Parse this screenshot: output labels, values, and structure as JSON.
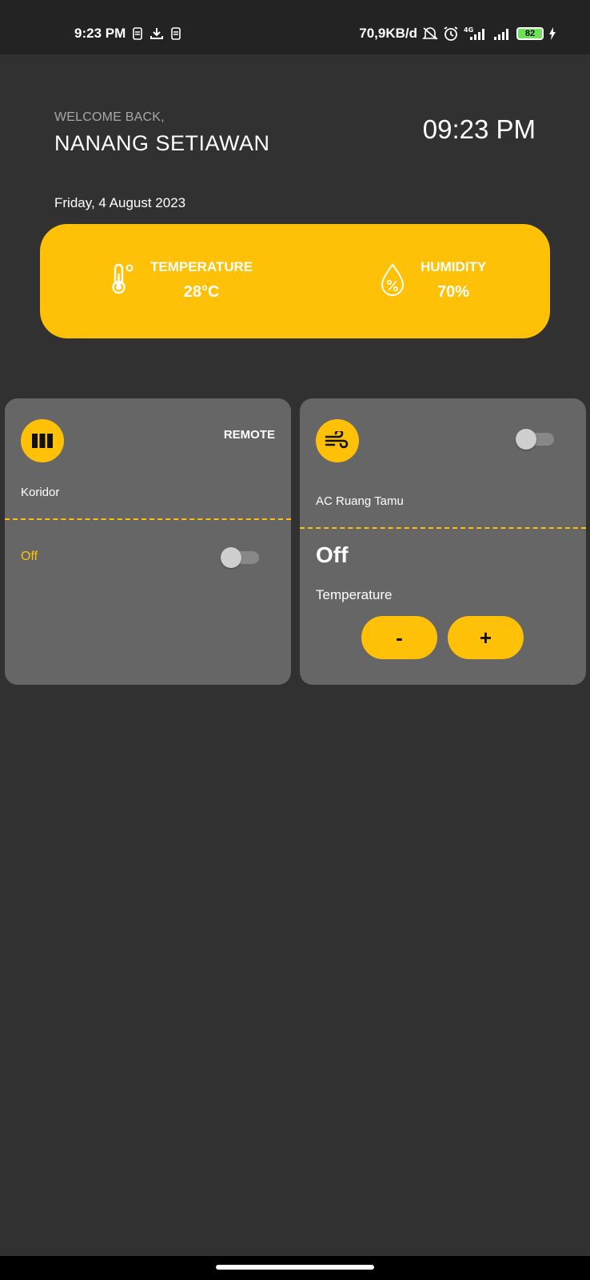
{
  "status_bar": {
    "time": "9:23 PM",
    "network_speed": "70,9KB/d",
    "network_type": "4G",
    "battery": "82",
    "icons": [
      "sim-icon",
      "download-icon",
      "sim-icon",
      "mute-icon",
      "alarm-icon",
      "signal-icon",
      "signal-icon",
      "charging-icon"
    ]
  },
  "header": {
    "welcome": "WELCOME BACK,",
    "username": "NANANG SETIAWAN",
    "clock": "09:23 PM",
    "date": "Friday, 4 August 2023"
  },
  "sensors": {
    "temperature": {
      "label": "TEMPERATURE",
      "value": "28°C",
      "icon": "thermometer-icon"
    },
    "humidity": {
      "label": "HUMIDITY",
      "value": "70%",
      "icon": "humidity-drop-icon"
    }
  },
  "devices": [
    {
      "name": "Koridor",
      "icon": "curtain-icon",
      "action_label": "REMOTE",
      "state": "Off",
      "toggle_on": false
    },
    {
      "name": "AC Ruang Tamu",
      "icon": "wind-icon",
      "state": "Off",
      "toggle_on": false,
      "temperature_label": "Temperature",
      "minus_label": "-",
      "plus_label": "+"
    }
  ],
  "colors": {
    "background": "#313131",
    "accent": "#ffc107",
    "card": "#666666",
    "status_bar": "#232323"
  }
}
